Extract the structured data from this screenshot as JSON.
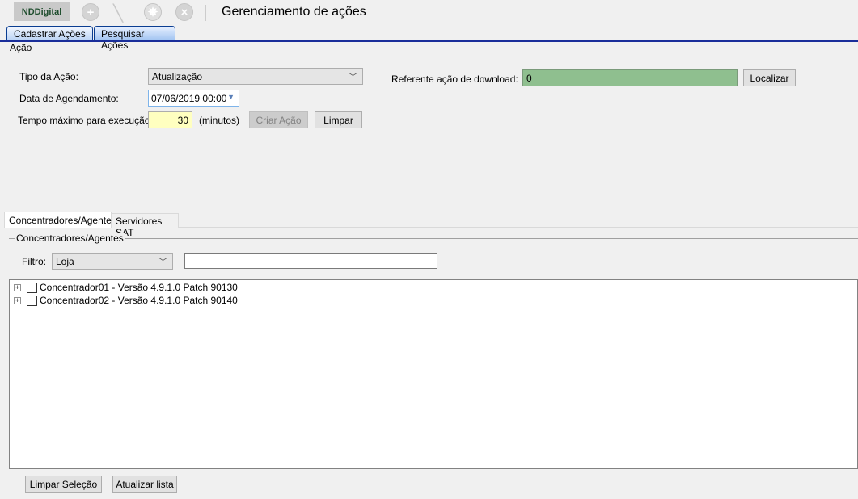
{
  "toolbar": {
    "logo": "NDDigital",
    "title": "Gerenciamento de ações",
    "icons": [
      "add-icon",
      "edit-icon",
      "settings-icon",
      "delete-icon"
    ]
  },
  "tabs": [
    {
      "label": "Cadastrar Ações"
    },
    {
      "label": "Pesquisar Ações"
    }
  ],
  "acao": {
    "group_label": "Ação",
    "tipo_label": "Tipo da Ação:",
    "tipo_value": "Atualização",
    "data_label": "Data de Agendamento:",
    "data_value": "07/06/2019 00:00",
    "tempo_label": "Tempo máximo para execução:",
    "tempo_value": "30",
    "tempo_unit": "(minutos)",
    "criar_button": "Criar Ação",
    "limpar_button": "Limpar",
    "referente_label": "Referente ação de download:",
    "referente_value": "0",
    "localizar_button": "Localizar"
  },
  "subtabs": [
    {
      "label": "Concentradores/Agentes"
    },
    {
      "label": "Servidores SAT"
    }
  ],
  "agentes": {
    "group_label": "Concentradores/Agentes",
    "filtro_label": "Filtro:",
    "filtro_value": "Loja",
    "filtro_text": "",
    "tree": [
      {
        "label": "Concentrador01  - Versão 4.9.1.0 Patch 90130"
      },
      {
        "label": "Concentrador02  - Versão 4.9.1.0 Patch 90140"
      }
    ],
    "limpar_selecao_button": "Limpar Seleção",
    "atualizar_button": "Atualizar lista"
  },
  "colors": {
    "accent": "#1a2e9a",
    "referente_bg": "#8fbf8f",
    "tempo_bg": "#ffffc0"
  }
}
